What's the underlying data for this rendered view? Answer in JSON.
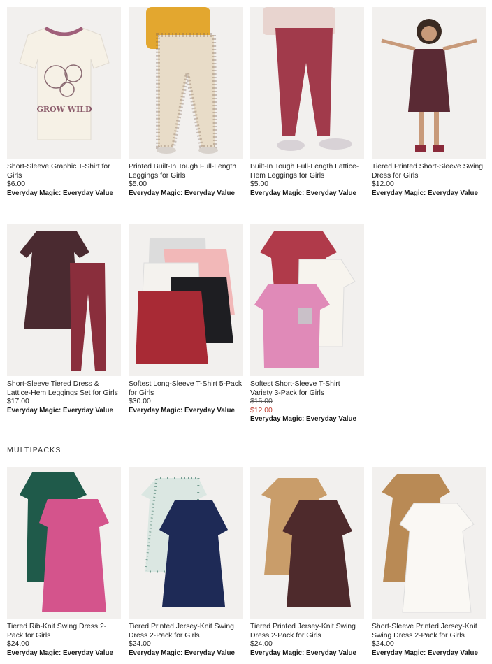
{
  "colors": {
    "sale": "#c0392b",
    "text": "#1a1a1a",
    "image_bg": "#f2f0ee"
  },
  "section": {
    "title": "MULTIPACKS"
  },
  "products": [
    {
      "title": "Short-Sleeve Graphic T-Shirt for Girls",
      "price": "$6.00",
      "tag": "Everyday Magic: Everyday Value",
      "graphic_text": "GROW WILD"
    },
    {
      "title": "Printed Built-In Tough Full-Length Leggings for Girls",
      "price": "$5.00",
      "tag": "Everyday Magic: Everyday Value"
    },
    {
      "title": "Built-In Tough Full-Length Lattice-Hem Leggings for Girls",
      "price": "$5.00",
      "tag": "Everyday Magic: Everyday Value"
    },
    {
      "title": "Tiered Printed Short-Sleeve Swing Dress for Girls",
      "price": "$12.00",
      "tag": "Everyday Magic: Everyday Value"
    },
    {
      "title": "Short-Sleeve Tiered Dress & Lattice-Hem Leggings Set for Girls",
      "price": "$17.00",
      "tag": "Everyday Magic: Everyday Value"
    },
    {
      "title": "Softest Long-Sleeve T-Shirt 5-Pack for Girls",
      "price": "$30.00",
      "tag": "Everyday Magic: Everyday Value"
    },
    {
      "title": "Softest Short-Sleeve T-Shirt Variety 3-Pack for Girls",
      "original_price": "$15.00",
      "sale_price": "$12.00",
      "tag": "Everyday Magic: Everyday Value"
    },
    {
      "title": "Tiered Rib-Knit Swing Dress 2-Pack for Girls",
      "price": "$24.00",
      "tag": "Everyday Magic: Everyday Value"
    },
    {
      "title": "Tiered Printed Jersey-Knit Swing Dress 2-Pack for Girls",
      "price": "$24.00",
      "tag": "Everyday Magic: Everyday Value"
    },
    {
      "title": "Tiered Printed Jersey-Knit Swing Dress 2-Pack for Girls",
      "price": "$24.00",
      "tag": "Everyday Magic: Everyday Value"
    },
    {
      "title": "Short-Sleeve Printed Jersey-Knit Swing Dress 2-Pack for Girls",
      "price": "$24.00",
      "tag": "Everyday Magic: Everyday Value"
    }
  ]
}
